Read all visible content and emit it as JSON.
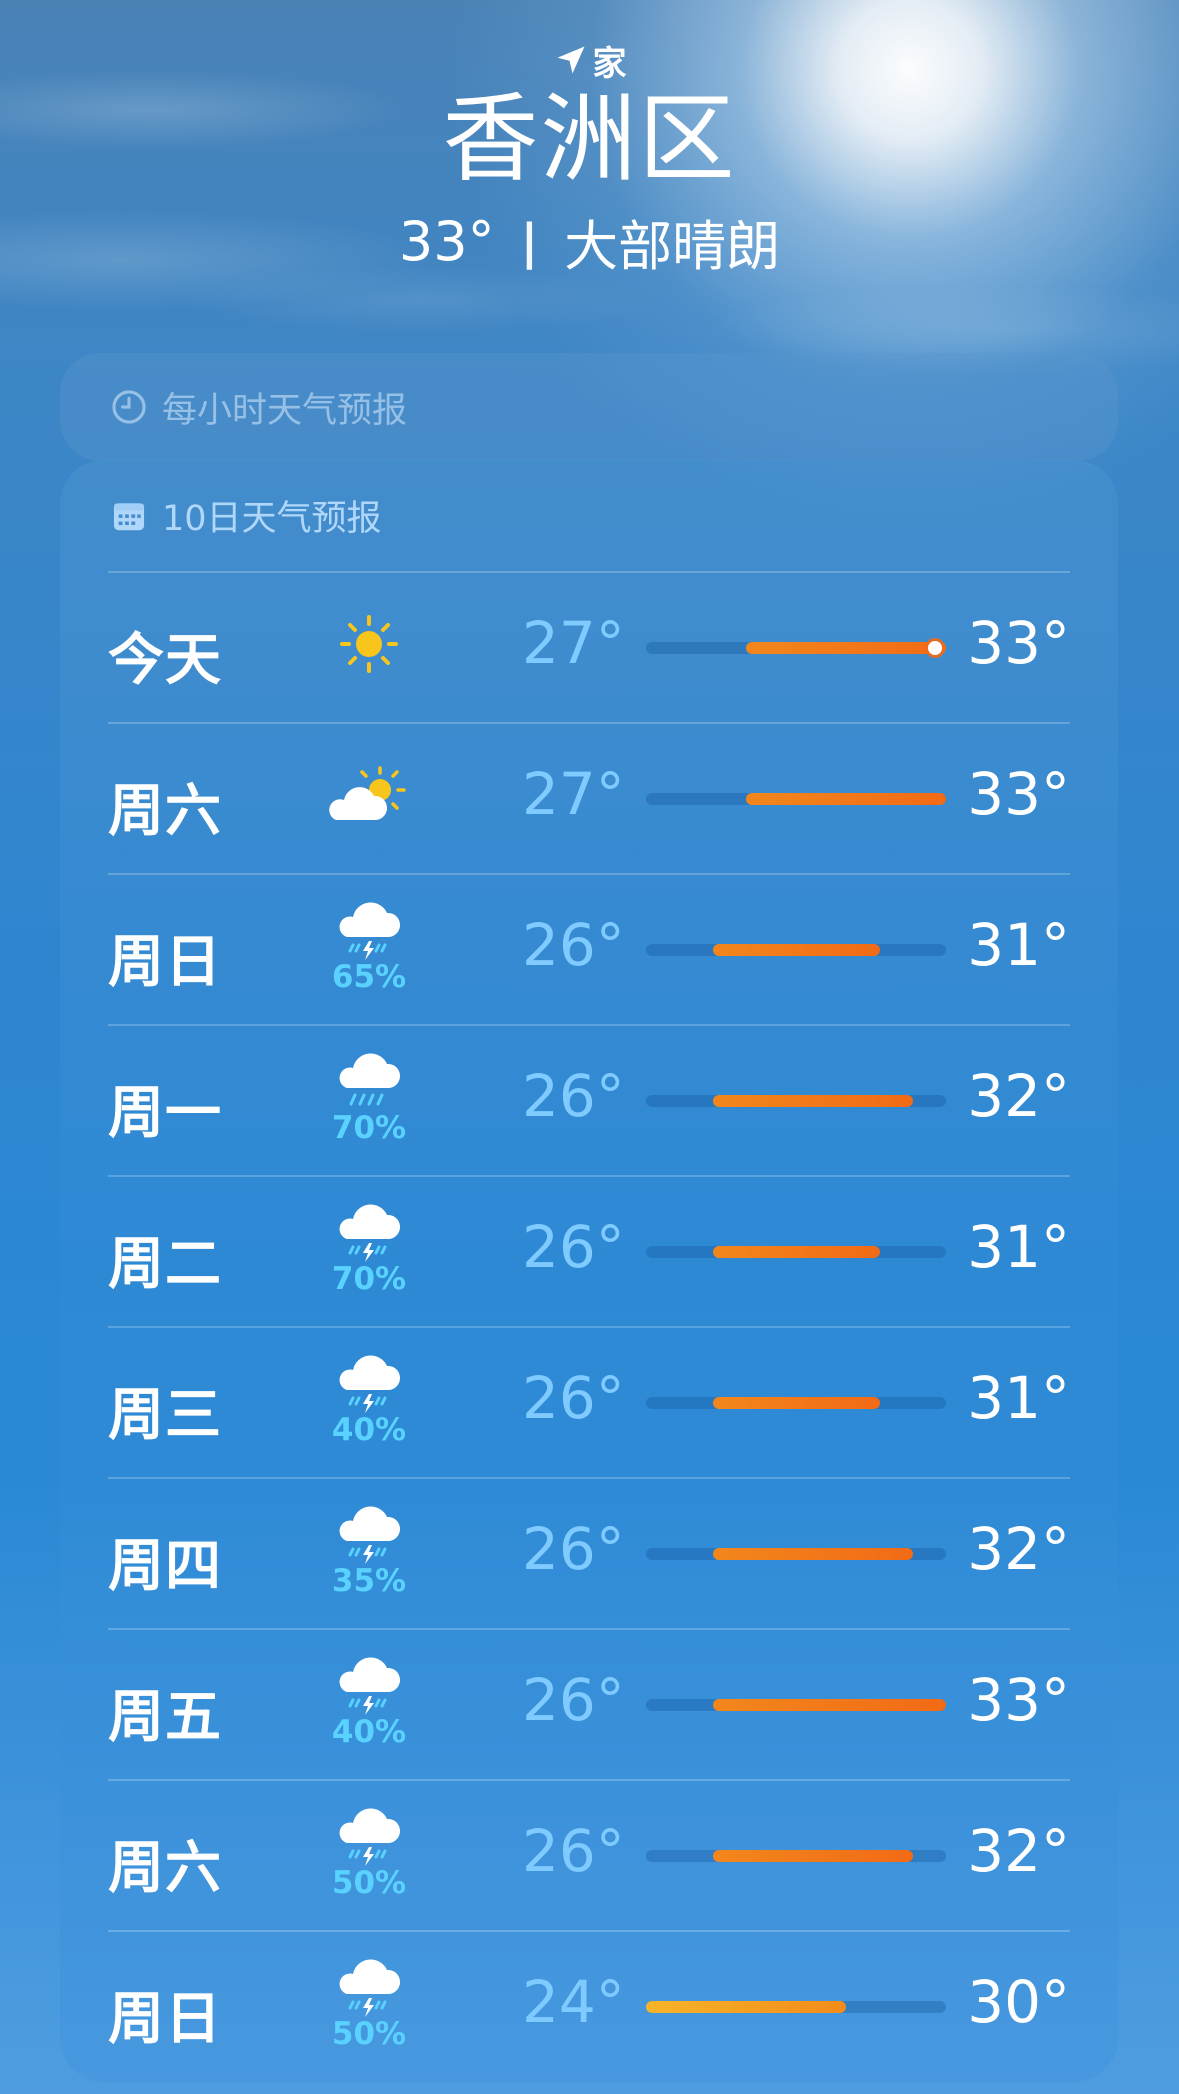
{
  "location": {
    "label": "家",
    "city": "香洲区"
  },
  "current": {
    "temp": "33°",
    "separator": "|",
    "condition": "大部晴朗"
  },
  "hourly": {
    "title": "每小时天气预报"
  },
  "daily": {
    "title": "10日天气预报",
    "scale_min": 24,
    "scale_max": 33,
    "days": [
      {
        "day": "今天",
        "icon": "sun-icon",
        "precip": "",
        "low": "27°",
        "high": "33°",
        "low_val": 27,
        "high_val": 33,
        "current_val": 33
      },
      {
        "day": "周六",
        "icon": "partly-cloudy-sun-icon",
        "precip": "",
        "low": "27°",
        "high": "33°",
        "low_val": 27,
        "high_val": 33
      },
      {
        "day": "周日",
        "icon": "thunderstorm-icon",
        "precip": "65%",
        "low": "26°",
        "high": "31°",
        "low_val": 26,
        "high_val": 31
      },
      {
        "day": "周一",
        "icon": "rain-cloud-icon",
        "precip": "70%",
        "low": "26°",
        "high": "32°",
        "low_val": 26,
        "high_val": 32
      },
      {
        "day": "周二",
        "icon": "thunderstorm-icon",
        "precip": "70%",
        "low": "26°",
        "high": "31°",
        "low_val": 26,
        "high_val": 31
      },
      {
        "day": "周三",
        "icon": "thunderstorm-icon",
        "precip": "40%",
        "low": "26°",
        "high": "31°",
        "low_val": 26,
        "high_val": 31
      },
      {
        "day": "周四",
        "icon": "thunderstorm-icon",
        "precip": "35%",
        "low": "26°",
        "high": "32°",
        "low_val": 26,
        "high_val": 32
      },
      {
        "day": "周五",
        "icon": "thunderstorm-icon",
        "precip": "40%",
        "low": "26°",
        "high": "33°",
        "low_val": 26,
        "high_val": 33
      },
      {
        "day": "周六",
        "icon": "thunderstorm-icon",
        "precip": "50%",
        "low": "26°",
        "high": "32°",
        "low_val": 26,
        "high_val": 32
      },
      {
        "day": "周日",
        "icon": "thunderstorm-icon",
        "precip": "50%",
        "low": "24°",
        "high": "30°",
        "low_val": 24,
        "high_val": 30
      }
    ]
  },
  "colors": {
    "bar_warm": "#f26a16",
    "bar_cool": "#f7b529",
    "precip": "#59d2ff",
    "low_temp": "#7fcaff"
  }
}
